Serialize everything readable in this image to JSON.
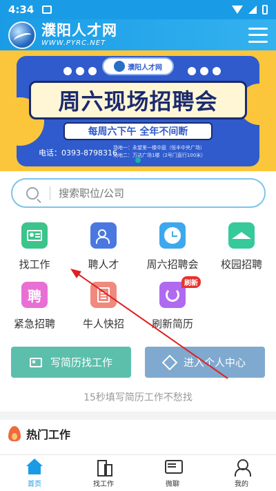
{
  "status_bar": {
    "time": "4:34"
  },
  "header": {
    "logo_name": "濮阳人才网",
    "logo_url_text": "WWW.PYRC.NET"
  },
  "banner": {
    "pill_text": "濮阳人才网",
    "title": "周六现场招聘会",
    "subtitle": "每周六下午 全年不间断",
    "phone": "电话：0393-8798316",
    "address_line1": "场地一：永望里一楼中庭（恒丰中央广场）",
    "address_line2": "场地二：万达广场1楼（2号门直行100米）"
  },
  "search": {
    "placeholder": "搜索职位/公司"
  },
  "grid": {
    "items": [
      {
        "label": "找工作",
        "icon": "id-card-icon",
        "color": "#3cc48a"
      },
      {
        "label": "聘人才",
        "icon": "people-icon",
        "color": "#4a78e0"
      },
      {
        "label": "周六招聘会",
        "icon": "clock-icon",
        "color": "#3ea8ee"
      },
      {
        "label": "校园招聘",
        "icon": "graduation-cap-icon",
        "color": "#36c99a"
      },
      {
        "label": "紧急招聘",
        "icon": "pin-char-icon",
        "glyph": "聘",
        "color": "#e86fd4"
      },
      {
        "label": "牛人快招",
        "icon": "document-icon",
        "color": "#f0897e"
      },
      {
        "label": "刷新简历",
        "icon": "refresh-icon",
        "color": "#b06af0",
        "badge": "刷新"
      }
    ]
  },
  "actions": {
    "write_resume": "写简历找工作",
    "personal_center": "进入个人中心"
  },
  "tagline": "15秒填写简历工作不愁找",
  "hot_jobs": {
    "title": "热门工作"
  },
  "bottom_nav": [
    {
      "label": "首页",
      "icon": "home-icon",
      "active": true
    },
    {
      "label": "找工作",
      "icon": "building-icon",
      "active": false
    },
    {
      "label": "微聊",
      "icon": "chat-icon",
      "active": false
    },
    {
      "label": "我的",
      "icon": "person-icon",
      "active": false
    }
  ],
  "colors": {
    "brand": "#1a9be6",
    "annotation_arrow": "#e02020",
    "banner_yellow": "#fbc63b",
    "banner_blue": "#2f5bcc"
  }
}
